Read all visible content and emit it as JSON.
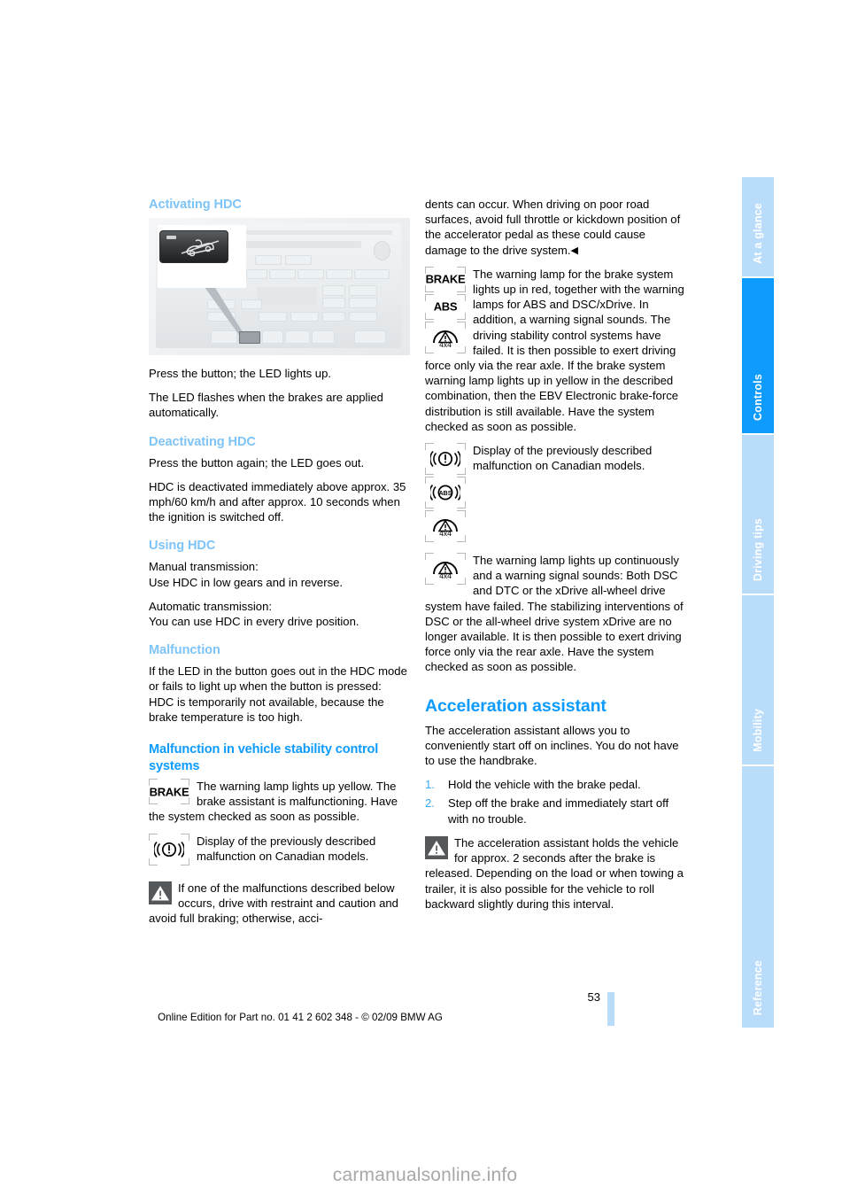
{
  "document": {
    "page_number": "53",
    "edition_line": "Online Edition for Part no. 01 41 2 602 348 - © 02/09 BMW AG",
    "watermark": "carmanualsonline.info",
    "image_reference": "HDC-41700a"
  },
  "colors": {
    "heading_strong": "#0d9bfd",
    "heading_light": "#7fc4f7",
    "tab_active": "#0d9bfd",
    "tab_inactive": "#b9dcfb",
    "list_number": "#3aabf9",
    "warning_icon": "#55585b"
  },
  "side_nav": {
    "items": [
      {
        "label": "At a glance",
        "active": false
      },
      {
        "label": "Controls",
        "active": true
      },
      {
        "label": "Driving tips",
        "active": false
      },
      {
        "label": "Mobility",
        "active": false
      },
      {
        "label": "Reference",
        "active": false
      }
    ]
  },
  "left_column": {
    "activating": {
      "heading": "Activating HDC",
      "p1": "Press the button; the LED lights up.",
      "p2": "The LED flashes when the brakes are applied automatically."
    },
    "deactivating": {
      "heading": "Deactivating HDC",
      "p1": "Press the button again; the LED goes out.",
      "p2": "HDC is deactivated immediately above approx. 35 mph/60 km/h and after approx. 10 seconds when the ignition is switched off."
    },
    "using": {
      "heading": "Using HDC",
      "p1": "Manual transmission:\nUse HDC in low gears and in reverse.",
      "p2": "Automatic transmission:\nYou can use HDC in every drive position."
    },
    "malfunction": {
      "heading": "Malfunction",
      "p1": "If the LED in the button goes out in the HDC mode or fails to light up when the button is pressed:\nHDC is temporarily not available, because the brake temperature is too high."
    },
    "stability": {
      "heading": "Malfunction in vehicle stability control systems",
      "brake_lamp": {
        "lamp_label": "BRAKE",
        "text": "The warning lamp lights up yellow. The brake assistant is malfunctioning. Have the system checked as soon as possible."
      },
      "canadian": {
        "lamp_label": "((!))",
        "text": "Display of the previously described malfunction on Canadian models."
      },
      "warning_note": "If one of the malfunctions described below occurs, drive with restraint and caution and avoid full braking; otherwise, acci-"
    }
  },
  "right_column": {
    "continued_note": "dents can occur. When driving on poor road surfaces, avoid full throttle or kickdown position of the accelerator pedal as these could cause damage to the drive system.",
    "brake_abs_group": {
      "lamps": [
        "BRAKE",
        "ABS",
        "4x4"
      ],
      "text": "The warning lamp for the brake system lights up in red, together with the warning lamps for ABS and DSC/xDrive. In addition, a warning signal sounds. The driving stability control systems have failed. It is then possible to exert driving force only via the rear axle. If the brake system warning lamp lights up in yellow in the described combination, then the EBV Electronic brake-force distribution is still available. Have the system checked as soon as possible."
    },
    "canadian_group": {
      "lamps": [
        "((!))",
        "((ABS))",
        "4x4"
      ],
      "text": "Display of the previously described malfunction on Canadian models."
    },
    "dsc_group": {
      "lamps": [
        "4x4"
      ],
      "text": "The warning lamp lights up continuously and a warning signal sounds: Both DSC and DTC or the xDrive all-wheel drive system have failed. The stabilizing interventions of DSC or the all-wheel drive system xDrive are no longer available. It is then possible to exert driving force only via the rear axle. Have the system checked as soon as possible."
    },
    "acceleration": {
      "heading": "Acceleration assistant",
      "intro": "The acceleration assistant allows you to conveniently start off on inclines. You do not have to use the handbrake.",
      "steps": [
        {
          "num": "1.",
          "text": "Hold the vehicle with the brake pedal."
        },
        {
          "num": "2.",
          "text": "Step off the brake and immediately start off with no trouble."
        }
      ],
      "note": "The acceleration assistant holds the vehicle for approx. 2 seconds after the brake is released. Depending on the load or when towing a trailer, it is also possible for the vehicle to roll backward slightly during this interval."
    }
  }
}
